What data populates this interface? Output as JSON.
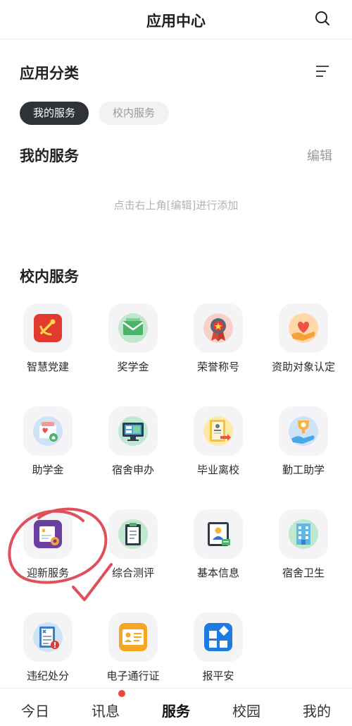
{
  "header": {
    "title": "应用中心",
    "search_icon": "search-icon"
  },
  "category": {
    "title": "应用分类",
    "filter_icon": "filter-lines-icon"
  },
  "chips": [
    {
      "label": "我的服务",
      "active": true
    },
    {
      "label": "校内服务",
      "active": false
    }
  ],
  "my_services": {
    "title": "我的服务",
    "edit_label": "编辑",
    "empty_hint": "点击右上角[编辑]进行添加"
  },
  "campus_services": {
    "title": "校内服务",
    "apps": [
      {
        "label": "智慧党建",
        "icon": "party-emblem-icon"
      },
      {
        "label": "奖学金",
        "icon": "scholarship-envelope-icon"
      },
      {
        "label": "荣誉称号",
        "icon": "honor-medal-icon"
      },
      {
        "label": "资助对象认定",
        "icon": "hand-heart-icon"
      },
      {
        "label": "助学金",
        "icon": "student-aid-icon"
      },
      {
        "label": "宿舍申办",
        "icon": "dorm-monitor-icon"
      },
      {
        "label": "毕业离校",
        "icon": "graduation-certificate-icon"
      },
      {
        "label": "勤工助学",
        "icon": "work-study-trophy-icon"
      },
      {
        "label": "迎新服务",
        "icon": "welcome-service-icon"
      },
      {
        "label": "综合测评",
        "icon": "evaluation-clipboard-icon"
      },
      {
        "label": "基本信息",
        "icon": "profile-card-icon"
      },
      {
        "label": "宿舍卫生",
        "icon": "dorm-building-icon"
      },
      {
        "label": "违纪处分",
        "icon": "discipline-document-icon"
      },
      {
        "label": "电子通行证",
        "icon": "e-pass-card-icon"
      },
      {
        "label": "报平安",
        "icon": "safety-report-icon"
      }
    ]
  },
  "tabs": [
    {
      "label": "今日",
      "active": false
    },
    {
      "label": "讯息",
      "active": false,
      "badge": true
    },
    {
      "label": "服务",
      "active": true
    },
    {
      "label": "校园",
      "active": false
    },
    {
      "label": "我的",
      "active": false
    }
  ],
  "colors": {
    "chip_active_bg": "#2f3236",
    "tile_bg": "#f4f4f6",
    "badge_red": "#e8463f",
    "annotation_red": "#d9313f"
  }
}
